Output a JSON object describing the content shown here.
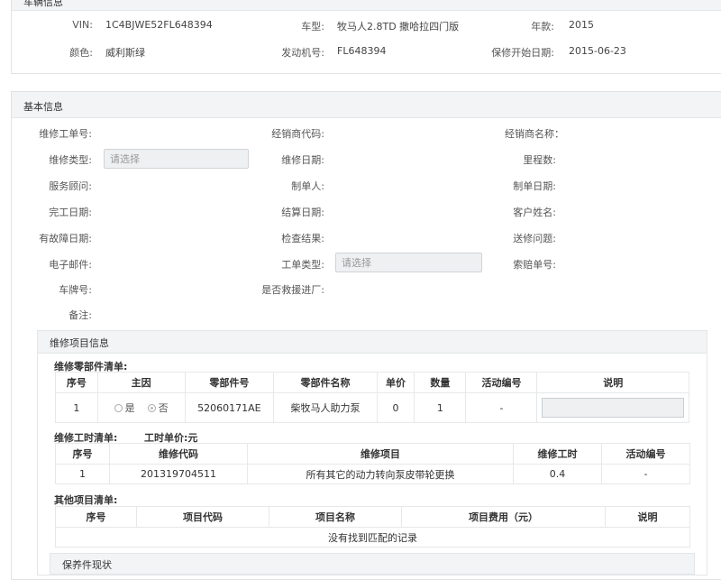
{
  "vehicle_panel": {
    "title": "车辆信息",
    "vin_label": "VIN:",
    "vin": "1C4BJWE52FL648394",
    "model_label": "车型:",
    "model": "牧马人2.8TD 撒哈拉四门版",
    "year_label": "年款:",
    "year": "2015",
    "color_label": "颜色:",
    "color": "威利斯绿",
    "engine_label": "发动机号:",
    "engine": "FL648394",
    "warranty_label": "保修开始日期:",
    "warranty": "2015-06-23"
  },
  "basic_panel": {
    "title": "基本信息",
    "fields": {
      "order_no": "维修工单号:",
      "dealer_code": "经销商代码:",
      "dealer_name": "经销商名称：",
      "repair_type": "维修类型:",
      "repair_date": "维修日期:",
      "mileage": "里程数:",
      "advisor": "服务顾问:",
      "creator": "制单人:",
      "create_date": "制单日期:",
      "finish_date": "完工日期:",
      "settle_date": "结算日期:",
      "customer": "客户姓名:",
      "fault_date": "有故障日期:",
      "check_result": "检查结果:",
      "repair_issue": "送修问题:",
      "email": "电子邮件:",
      "order_type": "工单类型:",
      "claim_no": "索赔单号:",
      "plate": "车牌号:",
      "rescue": "是否救援进厂:",
      "remark": "备注:"
    },
    "placeholder": "请选择"
  },
  "repair_items": {
    "title": "维修项目信息",
    "parts": {
      "title": "维修零部件清单:",
      "headers": [
        "序号",
        "主因",
        "零部件号",
        "零部件名称",
        "单价",
        "数量",
        "活动编号",
        "说明"
      ],
      "row": {
        "no": "1",
        "yes": "是",
        "no_opt": "否",
        "part_no": "52060171AE",
        "part_name": "柴牧马人助力泵",
        "price": "0",
        "qty": "1",
        "activity": "-"
      }
    },
    "labor": {
      "title": "维修工时清单:",
      "unit_price": "工时单价:元",
      "headers": [
        "序号",
        "维修代码",
        "维修项目",
        "维修工时",
        "活动编号"
      ],
      "row": {
        "no": "1",
        "code": "201319704511",
        "item": "所有其它的动力转向泵皮带轮更换",
        "hours": "0.4",
        "activity": "-"
      }
    },
    "other": {
      "title": "其他项目清单:",
      "headers": [
        "序号",
        "项目代码",
        "项目名称",
        "项目费用（元）",
        "说明"
      ],
      "empty": "没有找到匹配的记录"
    },
    "maintenance_title": "保养件现状"
  }
}
